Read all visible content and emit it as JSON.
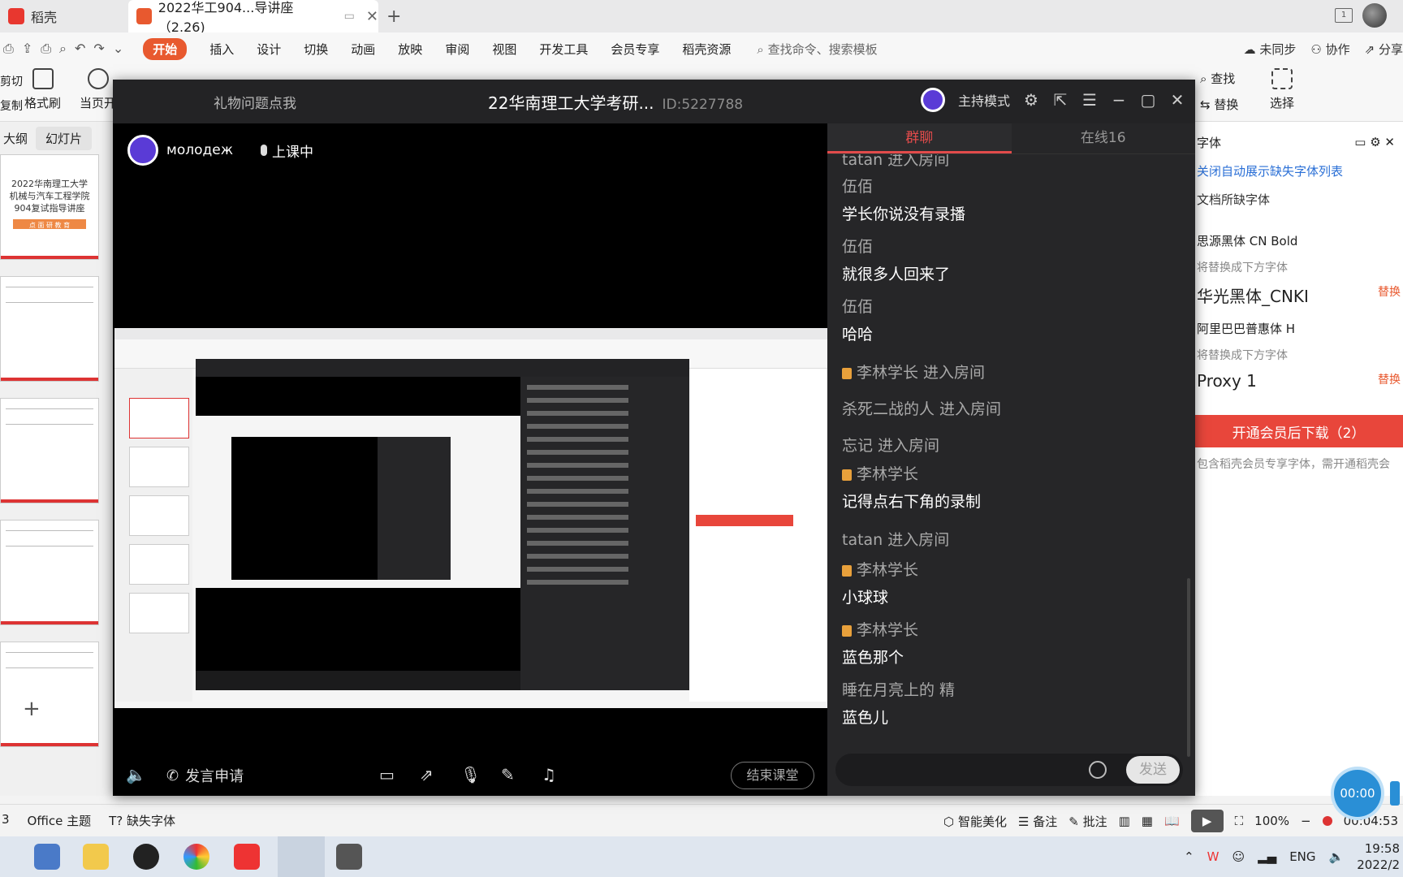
{
  "wps_tabs": {
    "home": "稻壳",
    "doc": "2022华工904...导讲座（2.26)"
  },
  "menubar": {
    "items": [
      "开始",
      "插入",
      "设计",
      "切换",
      "动画",
      "放映",
      "审阅",
      "视图",
      "开发工具",
      "会员专享",
      "稻壳资源"
    ],
    "search": "查找命令、搜索模板",
    "right": [
      "未同步",
      "协作",
      "分享"
    ]
  },
  "ribbon": {
    "cut": "剪切",
    "copy": "复制",
    "format_brush": "格式刷",
    "from_current": "当页开",
    "find": "查找",
    "replace": "替换",
    "select": "选择"
  },
  "leftpane": {
    "tabs": [
      "大纲",
      "幻灯片"
    ],
    "slide1": [
      "2022华南理工大学",
      "机械与汽车工程学院",
      "904复试指导讲座"
    ],
    "slide1_badge": "点 面 研 教 育"
  },
  "rightpane": {
    "title": "字体",
    "link": "关闭自动展示缺失字体列表",
    "missing": "文档所缺字体",
    "fonts": [
      {
        "name": "思源黑体 CN Bold",
        "hint": "将替换成下方字体",
        "replace": "华光黑体_CNKI",
        "action": "替换"
      },
      {
        "name": "阿里巴巴普惠体 H",
        "hint": "将替换成下方字体",
        "replace": "Proxy 1",
        "action": "替换"
      }
    ],
    "download": "开通会员后下载（2）",
    "note": "包含稻壳会员专享字体，需开通稻壳会"
  },
  "statusbar": {
    "slide": "3",
    "theme": "Office 主题",
    "missing_font": "缺失字体",
    "beautify": "智能美化",
    "notes": "备注",
    "comments": "批注",
    "zoom": "100%",
    "rec_time": "00:04:53"
  },
  "taskbar": {
    "lang": "ENG",
    "time": "19:58",
    "date": "2022/2"
  },
  "recorder": {
    "time": "00:00"
  },
  "modal": {
    "gift": "礼物问题点我",
    "room_name": "22华南理工大学考研...",
    "room_id": "ID:5227788",
    "mode": "主持模式",
    "host_name": "молодеж",
    "status": "上课中",
    "apply_speak": "发言申请",
    "end_class": "结束课堂",
    "chat_tabs": [
      "群聊",
      "在线16"
    ],
    "send": "发送"
  },
  "chat": {
    "partial": "tatan 进入房间",
    "messages": [
      {
        "user": "伍佰",
        "text": "学长你说没有录播",
        "tag": false
      },
      {
        "user": "伍佰",
        "text": "就很多人回来了",
        "tag": false
      },
      {
        "user": "伍佰",
        "text": "哈哈",
        "tag": false
      }
    ],
    "sys1": "李林学长 进入房间",
    "sys2": "杀死二战的人 进入房间",
    "sys3": "忘记 进入房间",
    "msg4": {
      "user": "李林学长",
      "text": "记得点右下角的录制"
    },
    "sys4": "tatan 进入房间",
    "msg5": {
      "user": "李林学长",
      "text": "小球球"
    },
    "msg6": {
      "user": "李林学长",
      "text": "蓝色那个"
    },
    "msg7": {
      "user": "睡在月亮上的 精",
      "text": "蓝色儿"
    }
  },
  "colors": {
    "wps_orange": "#e8592f",
    "chat_accent": "#e24b4b",
    "modal_bg": "#000000",
    "chat_bg": "#262628"
  }
}
